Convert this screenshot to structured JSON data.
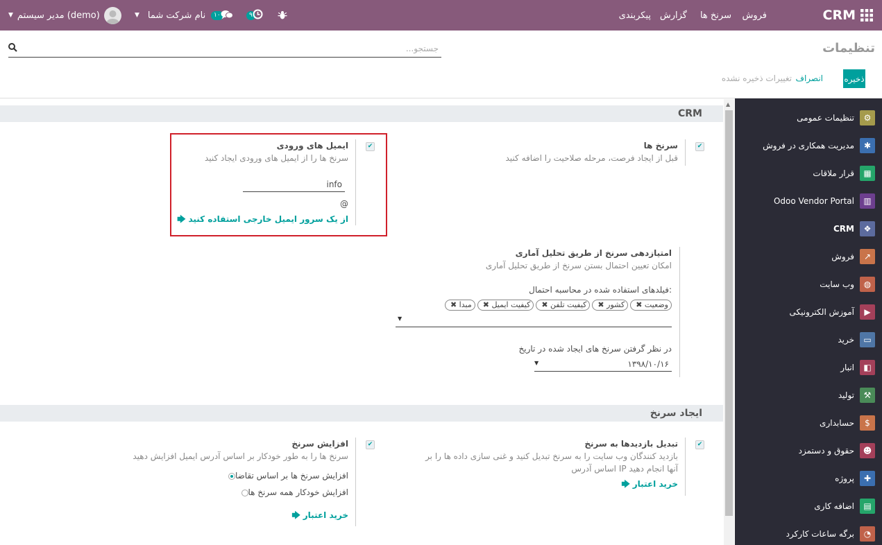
{
  "navbar": {
    "brand": "CRM",
    "menu": [
      "فروش",
      "سرنخ ها",
      "گزارش",
      "پیکربندی"
    ],
    "activities_count": "۹",
    "messages_count": "۱۰",
    "company": "نام شرکت شما",
    "user": "مدیر سیستم (demo)"
  },
  "control_panel": {
    "title": "تنظیمات",
    "search_placeholder": "جستجو...",
    "save": "ذخیره",
    "discard": "انصراف",
    "unsaved": "تغییرات ذخیره نشده"
  },
  "sidebar": {
    "items": [
      {
        "label": "تنظیمات عمومی",
        "icon": "gear-icon",
        "color": "#a59b4c"
      },
      {
        "label": "مدیریت همکاری در فروش",
        "icon": "team-icon",
        "color": "#3b6fb0"
      },
      {
        "label": "قرار ملاقات",
        "icon": "calendar-icon",
        "color": "#25a56a"
      },
      {
        "label": "Odoo Vendor Portal",
        "icon": "grid-icon",
        "color": "#6d3f8f"
      },
      {
        "label": "CRM",
        "icon": "handshake-icon",
        "color": "#5c6b9e"
      },
      {
        "label": "فروش",
        "icon": "chart-icon",
        "color": "#c9744a"
      },
      {
        "label": "وب سایت",
        "icon": "globe-icon",
        "color": "#c0624a"
      },
      {
        "label": "آموزش الکترونیکی",
        "icon": "elearning-icon",
        "color": "#a4405a"
      },
      {
        "label": "خرید",
        "icon": "card-icon",
        "color": "#4f76a6"
      },
      {
        "label": "انبار",
        "icon": "box-icon",
        "color": "#a4405a"
      },
      {
        "label": "تولید",
        "icon": "wrench-icon",
        "color": "#4a8b58"
      },
      {
        "label": "حسابداری",
        "icon": "invoice-icon",
        "color": "#c9744a"
      },
      {
        "label": "حقوق و دستمزد",
        "icon": "payroll-icon",
        "color": "#a4405a"
      },
      {
        "label": "پروژه",
        "icon": "puzzle-icon",
        "color": "#3b6fb0"
      },
      {
        "label": "اضافه کاری",
        "icon": "overtime-icon",
        "color": "#25a56a"
      },
      {
        "label": "برگه ساعات کارکرد",
        "icon": "stopwatch-icon",
        "color": "#c0624a"
      }
    ]
  },
  "crm_section": {
    "title": "CRM",
    "leads": {
      "title": "سرنخ ها",
      "desc": "قبل از ایجاد فرصت، مرحله صلاحیت را اضافه کنید"
    },
    "incoming_emails": {
      "title": "ایمیل های ورودی",
      "desc": "سرنخ ها را از ایمیل های ورودی ایجاد کنید",
      "alias_value": "info",
      "at_sign": "@",
      "external_server_link": "از یک سرور ایمیل خارجی استفاده کنید"
    },
    "scoring": {
      "title": "امتیازدهی سرنخ از طریق تحلیل آماری",
      "desc": "امکان تعیین احتمال بستن سرنخ از طریق تحلیل آماری",
      "fields_label": "فیلدهای استفاده شده در محاسبه احتمال:",
      "tags": [
        "وضعیت",
        "کشور",
        "کیفیت تلفن",
        "کیفیت ایمیل",
        "مبدا"
      ],
      "date_label": "در نظر گرفتن سرنخ های ایجاد شده در تاریخ",
      "date_value": "۱۳۹۸/۱۰/۱۶"
    }
  },
  "lead_generation": {
    "title": "ایجاد سرنخ",
    "visits": {
      "title": "تبدیل بازدیدها به سرنخ",
      "desc1": "بازدید کنندگان وب سایت را به سرنخ تبدیل کنید و غنی سازی داده ها را بر",
      "desc2": "اساس آدرس IP آنها انجام دهید",
      "link": "خرید اعتبار"
    },
    "enrichment": {
      "title": "افزایش سرنخ",
      "desc": "سرنخ ها را به طور خودکار بر اساس آدرس ایمیل افزایش دهید",
      "option_on_demand": "افزایش سرنخ ها بر اساس تقاضا",
      "option_auto": "افزایش خودکار همه سرنخ ها",
      "link": "خرید اعتبار"
    }
  }
}
